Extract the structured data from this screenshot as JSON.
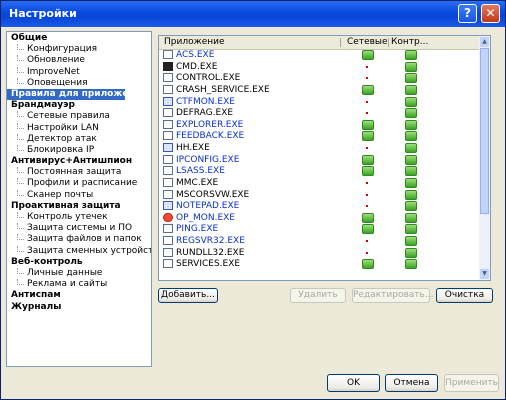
{
  "window": {
    "title": "Настройки",
    "help_label": "?",
    "close_label": "✕"
  },
  "nav": [
    {
      "label": "Общие",
      "type": "group"
    },
    {
      "label": "Конфигурация",
      "type": "child"
    },
    {
      "label": "Обновление",
      "type": "child"
    },
    {
      "label": "ImproveNet",
      "type": "child"
    },
    {
      "label": "Оповещения",
      "type": "child"
    },
    {
      "label": "Правила для приложений",
      "type": "group",
      "selected": true
    },
    {
      "label": "Брандмауэр",
      "type": "group"
    },
    {
      "label": "Сетевые правила",
      "type": "child"
    },
    {
      "label": "Настройки LAN",
      "type": "child"
    },
    {
      "label": "Детектор атак",
      "type": "child"
    },
    {
      "label": "Блокировка IP",
      "type": "child"
    },
    {
      "label": "Антивирус+Антишпион",
      "type": "group"
    },
    {
      "label": "Постоянная защита",
      "type": "child"
    },
    {
      "label": "Профили и расписание",
      "type": "child"
    },
    {
      "label": "Сканер почты",
      "type": "child"
    },
    {
      "label": "Проактивная защита",
      "type": "group"
    },
    {
      "label": "Контроль утечек",
      "type": "child"
    },
    {
      "label": "Защита системы и ПО",
      "type": "child"
    },
    {
      "label": "Защита файлов и папок",
      "type": "child"
    },
    {
      "label": "Защита сменных устройств",
      "type": "child"
    },
    {
      "label": "Веб-контроль",
      "type": "group"
    },
    {
      "label": "Личные данные",
      "type": "child"
    },
    {
      "label": "Реклама и сайты",
      "type": "child"
    },
    {
      "label": "Антиспам",
      "type": "group"
    },
    {
      "label": "Журналы",
      "type": "group"
    }
  ],
  "table": {
    "columns": {
      "app": "Приложение",
      "net": "Сетевые",
      "ctl": "Контр..."
    },
    "rows": [
      {
        "name": "ACS.EXE",
        "blue": true,
        "icon": "app-icon",
        "net": true,
        "ctl": true
      },
      {
        "name": "CMD.EXE",
        "blue": false,
        "icon": "console-icon",
        "net": false,
        "ctl": true
      },
      {
        "name": "CONTROL.EXE",
        "blue": false,
        "icon": "app-icon",
        "net": false,
        "ctl": true
      },
      {
        "name": "CRASH_SERVICE.EXE",
        "blue": false,
        "icon": "app-icon",
        "net": true,
        "ctl": true
      },
      {
        "name": "CTFMON.EXE",
        "blue": true,
        "icon": "pen-icon",
        "net": false,
        "ctl": true
      },
      {
        "name": "DEFRAG.EXE",
        "blue": false,
        "icon": "app-icon",
        "net": false,
        "ctl": true
      },
      {
        "name": "EXPLORER.EXE",
        "blue": true,
        "icon": "app-icon",
        "net": true,
        "ctl": true
      },
      {
        "name": "FEEDBACK.EXE",
        "blue": true,
        "icon": "app-icon",
        "net": true,
        "ctl": true
      },
      {
        "name": "HH.EXE",
        "blue": false,
        "icon": "help-icon",
        "net": false,
        "ctl": true
      },
      {
        "name": "IPCONFIG.EXE",
        "blue": true,
        "icon": "app-icon",
        "net": true,
        "ctl": true
      },
      {
        "name": "LSASS.EXE",
        "blue": true,
        "icon": "app-icon",
        "net": true,
        "ctl": true
      },
      {
        "name": "MMC.EXE",
        "blue": false,
        "icon": "app-icon",
        "net": false,
        "ctl": true
      },
      {
        "name": "MSCORSVW.EXE",
        "blue": false,
        "icon": "app-icon",
        "net": false,
        "ctl": true
      },
      {
        "name": "NOTEPAD.EXE",
        "blue": true,
        "icon": "notepad-icon",
        "net": false,
        "ctl": true
      },
      {
        "name": "OP_MON.EXE",
        "blue": true,
        "icon": "shield-icon",
        "net": true,
        "ctl": true
      },
      {
        "name": "PING.EXE",
        "blue": true,
        "icon": "app-icon",
        "net": true,
        "ctl": true
      },
      {
        "name": "REGSVR32.EXE",
        "blue": true,
        "icon": "app-icon",
        "net": false,
        "ctl": true
      },
      {
        "name": "RUNDLL32.EXE",
        "blue": false,
        "icon": "app-icon",
        "net": false,
        "ctl": true
      },
      {
        "name": "SERVICES.EXE",
        "blue": false,
        "icon": "app-icon",
        "net": true,
        "ctl": true
      }
    ]
  },
  "list_buttons": {
    "add": "Добавить...",
    "remove": "Удалить",
    "edit": "Редактировать...",
    "clear": "Очистка"
  },
  "dialog_buttons": {
    "ok": "OK",
    "cancel": "Отмена",
    "apply": "Применить"
  },
  "colors": {
    "title": "#0a4de0",
    "selection": "#316ac5",
    "link": "#0a32c8",
    "check": "#3aa225"
  }
}
